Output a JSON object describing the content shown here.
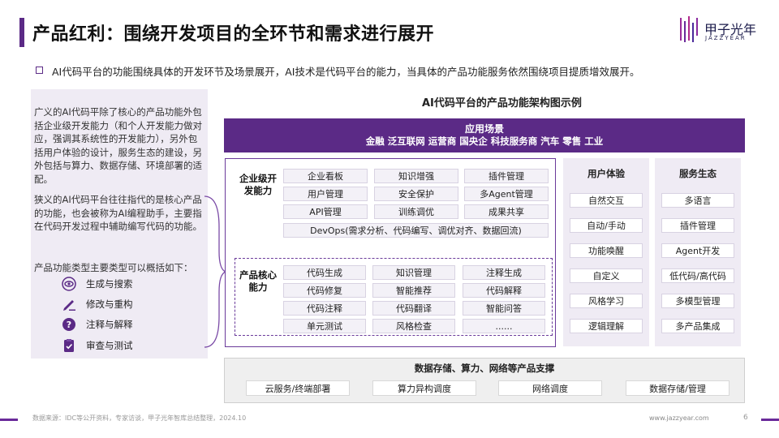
{
  "title": "产品红利：围绕开发项目的全环节和需求进行展开",
  "logo": {
    "name": "甲子光年",
    "sub": "JAZZYEAR"
  },
  "intro": "AI代码平台的功能围绕具体的开发环节及场景展开，AI技术是代码平台的能力，当具体的产品功能服务依然围绕项目提质增效展开。",
  "left_panel": {
    "p1": "广义的AI代码平除了核心的产品功能外包括企业级开发能力（和个人开发能力做对应，强调其系统性的开发能力），另外包括用户体验的设计，服务生态的建设，另外包括与算力、数据存储、环境部署的适配。",
    "p2": "狭义的AI代码平台往往指代的是核心产品的功能，也会被称为AI编程助手，主要指在代码开发过程中辅助编写代码的功能。",
    "p3": "产品功能类型主要类型可以概括如下：",
    "types": [
      {
        "icon": "eye-icon",
        "label": "生成与搜索"
      },
      {
        "icon": "pencil-icon",
        "label": "修改与重构"
      },
      {
        "icon": "question-icon",
        "label": "注释与解释"
      },
      {
        "icon": "checklist-icon",
        "label": "审查与测试"
      }
    ]
  },
  "diagram": {
    "title": "AI代码平台的产品功能架构图示例",
    "app": {
      "title": "应用场景",
      "list": "金融 泛互联网 运营商 国央企 科技服务商 汽车 零售 工业"
    },
    "enterprise": {
      "label": "企业级开发能力",
      "cells": [
        "企业看板",
        "知识增强",
        "插件管理",
        "用户管理",
        "安全保护",
        "多Agent管理",
        "API管理",
        "训练调优",
        "成果共享"
      ],
      "devops": "DevOps(需求分析、代码编写、调优对齐、数据回流)"
    },
    "core": {
      "label": "产品核心能力",
      "cells": [
        "代码生成",
        "知识管理",
        "注释生成",
        "代码修复",
        "智能推荐",
        "代码解释",
        "代码注释",
        "代码翻译",
        "智能问答",
        "单元测试",
        "风格检查",
        "......"
      ]
    },
    "ux": {
      "title": "用户体验",
      "items": [
        "自然交互",
        "自动/手动",
        "功能唤醒",
        "自定义",
        "风格学习",
        "逻辑理解"
      ]
    },
    "eco": {
      "title": "服务生态",
      "items": [
        "多语言",
        "插件管理",
        "Agent开发",
        "低代码/高代码",
        "多模型管理",
        "多产品集成"
      ]
    },
    "support": {
      "title": "数据存储、算力、网络等产品支撑",
      "items": [
        "云服务/终端部署",
        "算力异构调度",
        "网络调度",
        "数据存储/管理"
      ]
    }
  },
  "footer": {
    "source": "数据来源：IDC等公开资料，专家访谈，甲子光年智库总结整理，2024.10",
    "url": "www.jazzyear.com",
    "page": "6"
  },
  "colors": {
    "accent": "#5b2a86",
    "panel": "#efebf4"
  }
}
